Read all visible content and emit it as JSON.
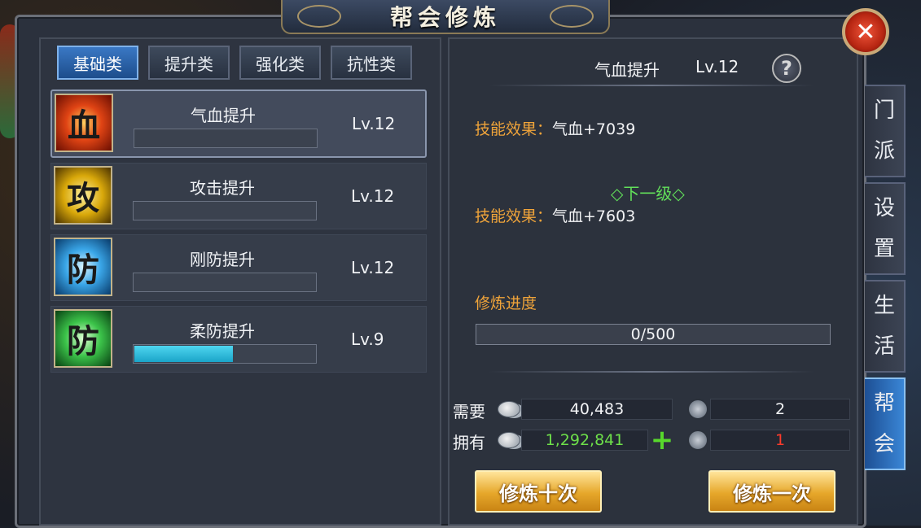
{
  "window": {
    "title": "帮会修炼"
  },
  "tabs": [
    {
      "label": "基础类",
      "active": true
    },
    {
      "label": "提升类",
      "active": false
    },
    {
      "label": "强化类",
      "active": false
    },
    {
      "label": "抗性类",
      "active": false
    }
  ],
  "skills": [
    {
      "name": "气血提升",
      "level": "Lv.12",
      "icon_glyph": "血",
      "icon": "blood-icon",
      "progress": 0,
      "selected": true
    },
    {
      "name": "攻击提升",
      "level": "Lv.12",
      "icon_glyph": "攻",
      "icon": "attack-icon",
      "progress": 0,
      "selected": false
    },
    {
      "name": "刚防提升",
      "level": "Lv.12",
      "icon_glyph": "防",
      "icon": "physical-defense-icon",
      "progress": 0,
      "selected": false
    },
    {
      "name": "柔防提升",
      "level": "Lv.9",
      "icon_glyph": "防",
      "icon": "magic-defense-icon",
      "progress": 0.54,
      "selected": false
    }
  ],
  "detail": {
    "name": "气血提升",
    "level": "Lv.12",
    "help_glyph": "?",
    "effect_label": "技能效果：",
    "current_effect": "气血+7039",
    "next_level_label": "◇下一级◇",
    "next_effect": "气血+7603",
    "progress_label": "修炼进度",
    "progress_text": "0/500"
  },
  "cost": {
    "need_label": "需要",
    "have_label": "拥有",
    "need_silver": "40,483",
    "have_silver": "1,292,841",
    "need_token": "2",
    "have_token": "1",
    "plus_glyph": "+"
  },
  "buttons": {
    "train_ten": "修炼十次",
    "train_once": "修炼一次",
    "close_glyph": "✕"
  },
  "side_tabs": [
    {
      "label": "门派",
      "chars": [
        "门",
        "派"
      ],
      "active": false
    },
    {
      "label": "设置",
      "chars": [
        "设",
        "置"
      ],
      "active": false
    },
    {
      "label": "生活",
      "chars": [
        "生",
        "活"
      ],
      "active": false
    },
    {
      "label": "帮会",
      "chars": [
        "帮",
        "会"
      ],
      "active": true
    }
  ],
  "colors": {
    "accent_orange": "#f0a43a",
    "green_text": "#62e05a",
    "red_text": "#ff3b2b",
    "silver_green": "#6ee04a",
    "progress_cyan": "#1aa4c8"
  }
}
